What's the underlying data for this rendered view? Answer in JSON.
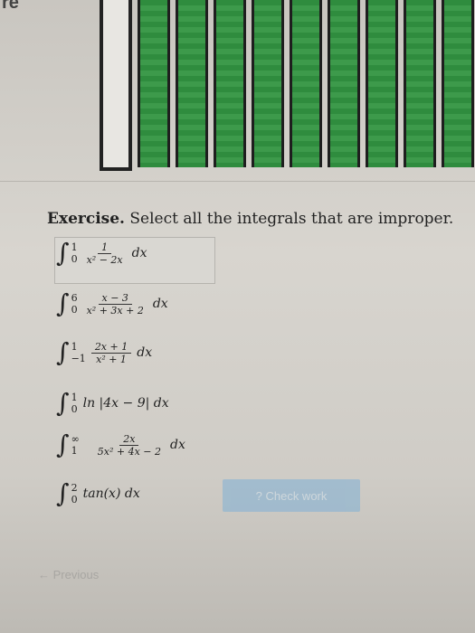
{
  "header_fragment": "re",
  "exercise": {
    "label": "Exercise.",
    "text": "Select all the integrals that are improper."
  },
  "options": [
    {
      "lower": "0",
      "upper": "1",
      "num": "1",
      "den": "x² − 2x",
      "tail": "dx"
    },
    {
      "lower": "0",
      "upper": "6",
      "num": "x − 3",
      "den": "x² + 3x + 2",
      "tail": "dx"
    },
    {
      "lower": "−1",
      "upper": "1",
      "num": "2x + 1",
      "den": "x² + 1",
      "tail": "dx"
    },
    {
      "lower": "0",
      "upper": "1",
      "expr": "ln |4x − 9| dx"
    },
    {
      "lower": "1",
      "upper": "∞",
      "num": "2x",
      "den": "5x² + 4x − 2",
      "tail": "dx"
    },
    {
      "lower": "0",
      "upper": "2",
      "expr": "tan(x) dx"
    }
  ],
  "buttons": {
    "check": "Check work",
    "previous": "Previous"
  }
}
